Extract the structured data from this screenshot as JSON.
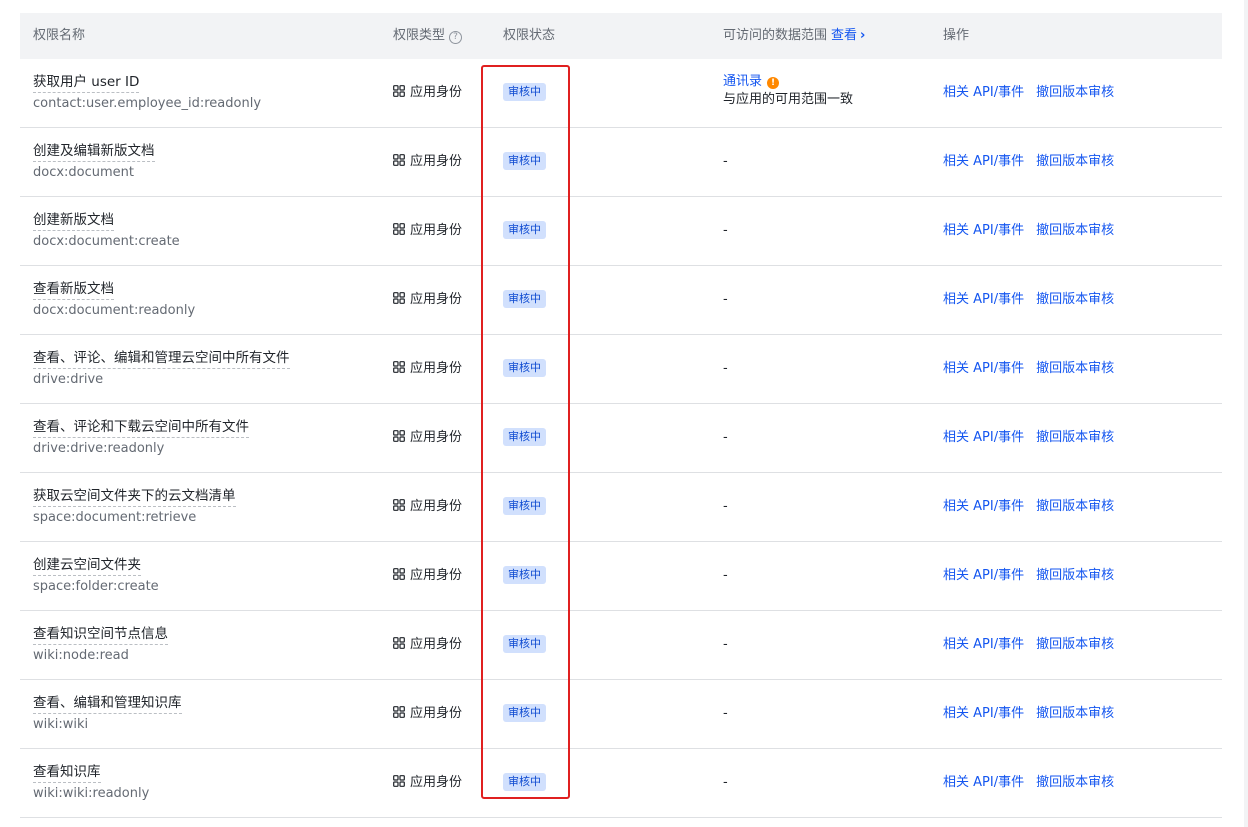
{
  "header": {
    "name": "权限名称",
    "type": "权限类型",
    "type_help_icon": "question-circle-icon",
    "status": "权限状态",
    "range": "可访问的数据范围",
    "range_view": "查看",
    "range_view_icon": "chevron-right-icon",
    "ops": "操作"
  },
  "ops": {
    "related": "相关 API/事件",
    "withdraw": "撤回版本审核"
  },
  "colors": {
    "link": "#1456f0",
    "badge_bg": "#d1e0fd",
    "badge_text": "#0f4bd1",
    "warning": "#ff8800",
    "highlight": "#e02020"
  },
  "rows": [
    {
      "title": "获取用户 user ID",
      "key": "contact:user.employee_id:readonly",
      "type": "应用身份",
      "status": "审核中",
      "range_link": "通讯录",
      "range_note": "与应用的可用范围一致",
      "range_icon": "warning-icon"
    },
    {
      "title": "创建及编辑新版文档",
      "key": "docx:document",
      "type": "应用身份",
      "status": "审核中",
      "range": "-"
    },
    {
      "title": "创建新版文档",
      "key": "docx:document:create",
      "type": "应用身份",
      "status": "审核中",
      "range": "-"
    },
    {
      "title": "查看新版文档",
      "key": "docx:document:readonly",
      "type": "应用身份",
      "status": "审核中",
      "range": "-"
    },
    {
      "title": "查看、评论、编辑和管理云空间中所有文件",
      "key": "drive:drive",
      "type": "应用身份",
      "status": "审核中",
      "range": "-"
    },
    {
      "title": "查看、评论和下载云空间中所有文件",
      "key": "drive:drive:readonly",
      "type": "应用身份",
      "status": "审核中",
      "range": "-"
    },
    {
      "title": "获取云空间文件夹下的云文档清单",
      "key": "space:document:retrieve",
      "type": "应用身份",
      "status": "审核中",
      "range": "-"
    },
    {
      "title": "创建云空间文件夹",
      "key": "space:folder:create",
      "type": "应用身份",
      "status": "审核中",
      "range": "-"
    },
    {
      "title": "查看知识空间节点信息",
      "key": "wiki:node:read",
      "type": "应用身份",
      "status": "审核中",
      "range": "-"
    },
    {
      "title": "查看、编辑和管理知识库",
      "key": "wiki:wiki",
      "type": "应用身份",
      "status": "审核中",
      "range": "-"
    },
    {
      "title": "查看知识库",
      "key": "wiki:wiki:readonly",
      "type": "应用身份",
      "status": "审核中",
      "range": "-"
    }
  ]
}
